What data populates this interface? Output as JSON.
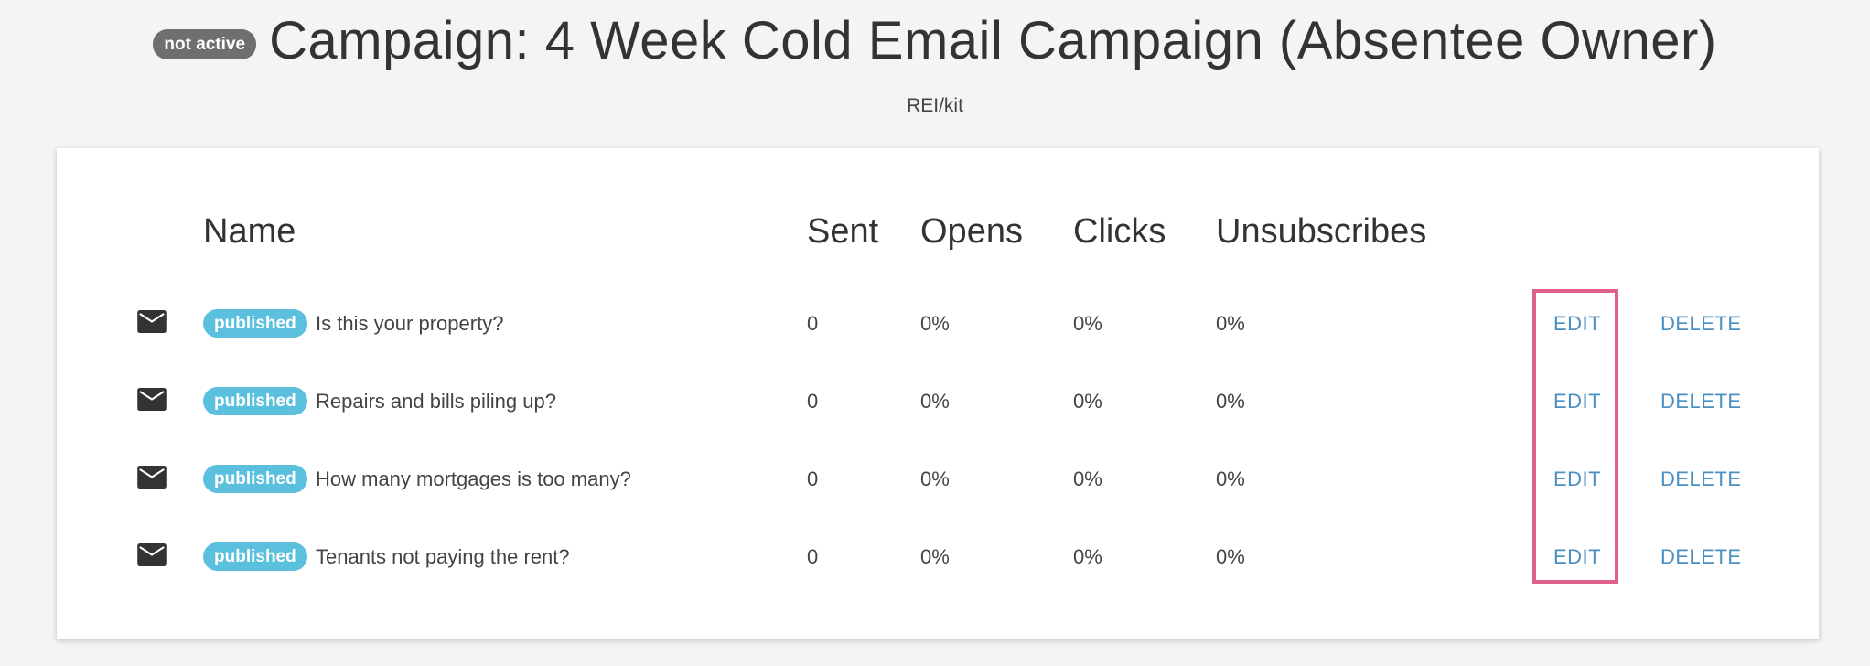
{
  "header": {
    "status_label": "not active",
    "title": "Campaign: 4 Week Cold Email Campaign (Absentee Owner)",
    "subtitle": "REI/kit"
  },
  "table": {
    "columns": {
      "name": "Name",
      "sent": "Sent",
      "opens": "Opens",
      "clicks": "Clicks",
      "unsubscribes": "Unsubscribes"
    },
    "rows": [
      {
        "status": "published",
        "name": "Is this your property?",
        "sent": "0",
        "opens": "0%",
        "clicks": "0%",
        "unsubscribes": "0%",
        "edit": "EDIT",
        "delete": "DELETE"
      },
      {
        "status": "published",
        "name": "Repairs and bills piling up?",
        "sent": "0",
        "opens": "0%",
        "clicks": "0%",
        "unsubscribes": "0%",
        "edit": "EDIT",
        "delete": "DELETE"
      },
      {
        "status": "published",
        "name": "How many mortgages is too many?",
        "sent": "0",
        "opens": "0%",
        "clicks": "0%",
        "unsubscribes": "0%",
        "edit": "EDIT",
        "delete": "DELETE"
      },
      {
        "status": "published",
        "name": "Tenants not paying the rent?",
        "sent": "0",
        "opens": "0%",
        "clicks": "0%",
        "unsubscribes": "0%",
        "edit": "EDIT",
        "delete": "DELETE"
      }
    ],
    "row_icon": "envelope-icon"
  },
  "colors": {
    "background": "#f3f4f6",
    "status_inactive": "#6f6f6f",
    "status_published": "#5bc0de",
    "action_link": "#4a8fc2",
    "highlight": "#e06090"
  }
}
